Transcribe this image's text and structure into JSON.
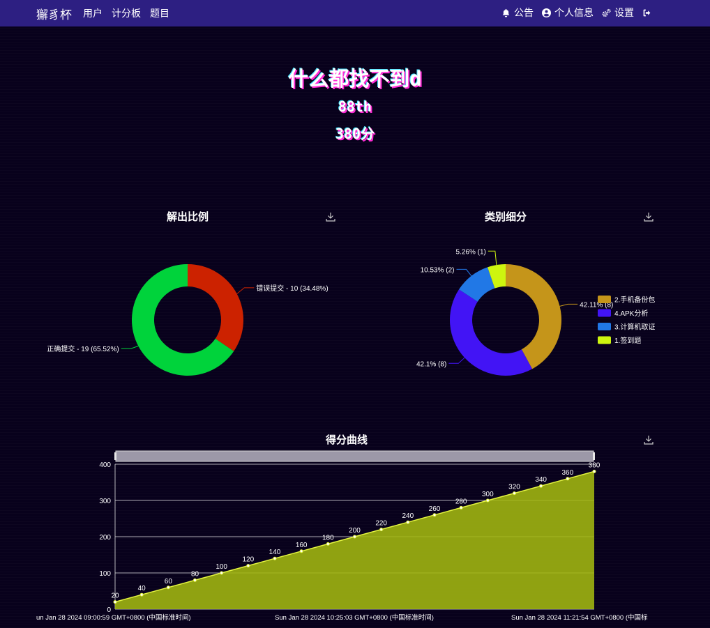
{
  "nav": {
    "brand": "獬豸杯",
    "users": "用户",
    "scoreboard": "计分板",
    "challenges": "题目",
    "notice": "公告",
    "profile": "个人信息",
    "settings": "设置"
  },
  "profile": {
    "name": "什么都找不到d",
    "place": "88th",
    "score": "380分"
  },
  "charts": {
    "solve_title": "解出比例",
    "category_title": "类别细分",
    "score_title": "得分曲线"
  },
  "colors": {
    "correct": "#00d33b",
    "wrong": "#cc2200",
    "cat1": "#c5951a",
    "cat2": "#4214f5",
    "cat3": "#2178e6",
    "cat4": "#cdf50f",
    "area": "#a3b810",
    "navbar": "#2d1f82",
    "background": "#08011c"
  },
  "chart_data": [
    {
      "type": "pie",
      "title": "解出比例",
      "labels": [
        "错误提交",
        "正确提交"
      ],
      "values": [
        10,
        19
      ],
      "data_labels": [
        "错误提交 - 10 (34.48%)",
        "正确提交 - 19 (65.52%)"
      ]
    },
    {
      "type": "pie",
      "title": "类别细分",
      "labels": [
        "2.手机备份包",
        "4.APK分析",
        "3.计算机取证",
        "1.签到题"
      ],
      "values": [
        8,
        8,
        2,
        1
      ],
      "data_labels": [
        "42.11% (8)",
        "42.1% (8)",
        "10.53% (2)",
        "5.26% (1)"
      ],
      "legend_position": "right"
    },
    {
      "type": "area",
      "title": "得分曲线",
      "values": [
        20,
        40,
        60,
        80,
        100,
        120,
        140,
        160,
        180,
        200,
        220,
        240,
        260,
        280,
        300,
        320,
        340,
        360,
        380
      ],
      "y_ticks": [
        0,
        100,
        200,
        300,
        400
      ],
      "ylim": [
        0,
        400
      ],
      "x_tick_labels": [
        "un Jan 28 2024 09:00:59 GMT+0800 (中国标准时间)",
        "Sun Jan 28 2024 10:25:03 GMT+0800 (中国标准时间)",
        "Sun Jan 28 2024 11:21:54 GMT+0800 (中国标"
      ],
      "grid": true
    }
  ]
}
